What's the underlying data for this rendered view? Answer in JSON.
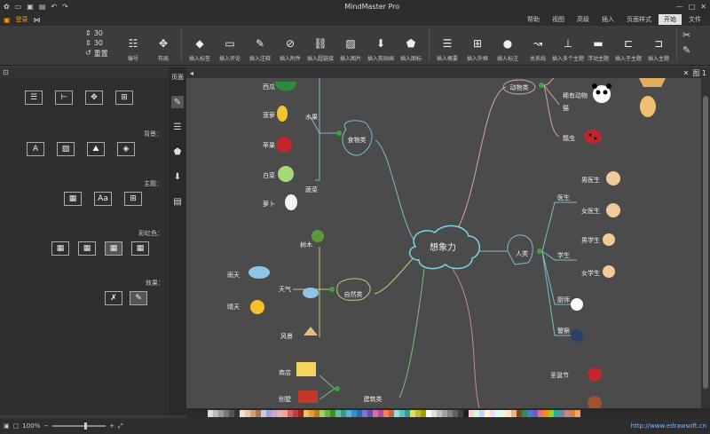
{
  "app": {
    "title": "MindMaster Pro",
    "login_label": "登录"
  },
  "tabs": [
    "文件",
    "开始",
    "页面样式",
    "插入",
    "高级",
    "视图",
    "帮助"
  ],
  "active_tab": "开始",
  "ribbon": {
    "buttons": [
      "插入主题",
      "插入子主题",
      "浮动主题",
      "插入多个主题",
      "关系线",
      "插入标注",
      "插入外框",
      "插入概要",
      "插入图标",
      "插入剪贴画",
      "插入图片",
      "插入超链接",
      "插入附件",
      "插入注释",
      "插入评论",
      "插入标签",
      "布局",
      "编号"
    ],
    "spin1": "30",
    "spin2": "30",
    "reset_label": "重置"
  },
  "left_panel": {
    "title": "页面",
    "section_background": "背景：",
    "section_theme": "主题：",
    "section_color": "彩虹色：",
    "section_effect": "效果："
  },
  "canvas_tab": "图 1",
  "map": {
    "center": "想象力",
    "animals": {
      "label": "动物类",
      "items": [
        "狗",
        "熊猫",
        "猫",
        "瓢虫"
      ],
      "sub_rare": "稀有动物"
    },
    "people": {
      "label": "人类",
      "cat1": "医生",
      "cat2": "学生",
      "cat3": "厨师",
      "cat4": "警察",
      "items": [
        "男医生",
        "女医生",
        "男学生",
        "女学生",
        "厨师",
        "警察"
      ]
    },
    "fruits": {
      "label": "食物类",
      "sub_fruit": "水果",
      "sub_veg": "蔬菜",
      "items": [
        "西瓜",
        "菠萝",
        "苹果",
        "白菜",
        "萝卜"
      ]
    },
    "nature": {
      "label": "自然类",
      "sub_weather": "天气",
      "items": [
        "树木",
        "雨天",
        "晴天",
        "风景"
      ]
    },
    "buildings": {
      "label": "建筑类",
      "items": [
        "商店",
        "别墅"
      ]
    },
    "holiday": {
      "label": "圣诞节"
    }
  },
  "status": {
    "zoom": "100%",
    "url": "http://www.edrawsoft.cn"
  },
  "colors": {
    "canvas": "#4b4b4b",
    "accent": "#f39c12"
  }
}
